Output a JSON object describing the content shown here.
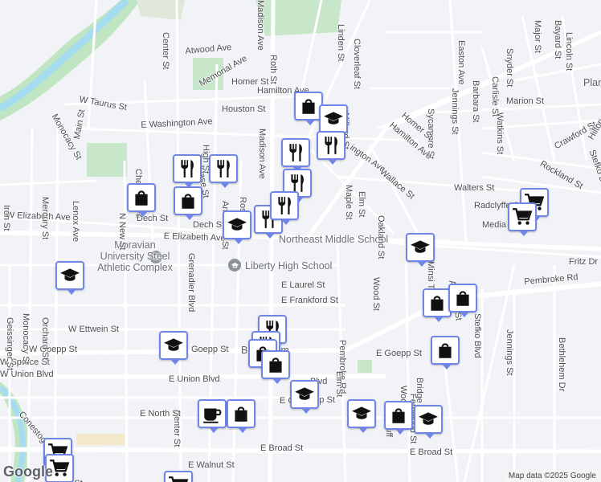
{
  "map": {
    "brand": "Google",
    "attribution": "Map data ©2025 Google"
  },
  "poi": {
    "schools": [
      {
        "name": "Northeast Middle School"
      },
      {
        "name": "Liberty High School"
      },
      {
        "name": "Moravian University Steel Athletic Complex"
      }
    ]
  },
  "labels": {
    "streets": [
      "W Taurus St",
      "Monocacy St",
      "Main St",
      "Chelsea Ave",
      "Lenox Ave",
      "N New St",
      "Center St",
      "Atwood Ave",
      "Memorial Ave",
      "Homer St",
      "Hamilton Ave",
      "Houston St",
      "E Washington Ave",
      "High St",
      "Klase St",
      "Madison Ave",
      "Roth St",
      "Linden St",
      "Cloverleaf St",
      "Millard St",
      "W Elizabeth Ave",
      "E Elizabeth Ave",
      "Dech St",
      "Anderson St",
      "Rose Ave",
      "Grenadier Blvd",
      "E Laurel St",
      "E Frankford St",
      "W Ettwein St",
      "W Goepp St",
      "E Goepp St",
      "W Spruce St",
      "W Union Blvd",
      "E Union Blvd",
      "E North St",
      "E Broad St",
      "E Walnut St",
      "Pembroke Rd",
      "Easton Ave",
      "Jennings St",
      "Barbara St",
      "Carlisle St",
      "Sycamore St",
      "Watkins St",
      "Marion St",
      "Snyder St",
      "Major St",
      "Bayard St",
      "Lincoln St",
      "Maple St",
      "Elm St",
      "Wallace St",
      "Oakland St",
      "Walters St",
      "Radclyffe St",
      "Media St",
      "Crawford St",
      "Rockland St",
      "Hilton St",
      "Stefko Blvd",
      "Fritz Dr",
      "Mincer St",
      "Arcadia St",
      "Bethlehem Dr",
      "Wood St",
      "Fernwood St",
      "Woodruff St",
      "Bridge St",
      "Geissinger St",
      "Orchard St",
      "Mercury St",
      "Irons St",
      "Conestoga St",
      "Broad St",
      "Ettwein St"
    ],
    "labels_visible": [
      {
        "key": "w_taurus",
        "text": "W Taurus St"
      },
      {
        "key": "monocacy",
        "text": "Monocacy St"
      },
      {
        "key": "main",
        "text": "Main St"
      },
      {
        "key": "chelsea",
        "text": "Chelsea Ave"
      },
      {
        "key": "lenox",
        "text": "Lenox Ave"
      },
      {
        "key": "n_new",
        "text": "N New St"
      },
      {
        "key": "center_top",
        "text": "Center St"
      },
      {
        "key": "center_bot",
        "text": "Center St"
      },
      {
        "key": "atwood",
        "text": "Atwood Ave"
      },
      {
        "key": "memorial",
        "text": "Memorial Ave"
      },
      {
        "key": "homer_w",
        "text": "Homer St"
      },
      {
        "key": "hamilton_w",
        "text": "Hamilton Ave"
      },
      {
        "key": "houston",
        "text": "Houston St"
      },
      {
        "key": "e_washington",
        "text": "E Washington Ave"
      },
      {
        "key": "high",
        "text": "High St"
      },
      {
        "key": "klase",
        "text": "Klase St"
      },
      {
        "key": "madison_top",
        "text": "Madison Ave"
      },
      {
        "key": "madison_mid",
        "text": "Madison Ave"
      },
      {
        "key": "roth",
        "text": "Roth St"
      },
      {
        "key": "linden",
        "text": "Linden St"
      },
      {
        "key": "cloverleaf",
        "text": "Cloverleaf St"
      },
      {
        "key": "millard",
        "text": "Millard St"
      },
      {
        "key": "w_elizabeth",
        "text": "W Elizabeth Ave"
      },
      {
        "key": "e_elizabeth",
        "text": "E Elizabeth Ave"
      },
      {
        "key": "dech_w",
        "text": "Dech St"
      },
      {
        "key": "dech_e",
        "text": "Dech St"
      },
      {
        "key": "anderson",
        "text": "Anderson St"
      },
      {
        "key": "rose",
        "text": "Rose Ave"
      },
      {
        "key": "grenadier",
        "text": "Grenadier Blvd"
      },
      {
        "key": "e_laurel",
        "text": "E Laurel St"
      },
      {
        "key": "e_frankford",
        "text": "E Frankford St"
      },
      {
        "key": "w_ettwein",
        "text": "W Ettwein St"
      },
      {
        "key": "w_goepp",
        "text": "W Goepp St"
      },
      {
        "key": "goepp_mid",
        "text": "Goepp St"
      },
      {
        "key": "e_goepp",
        "text": "E Goepp St"
      },
      {
        "key": "w_spruce",
        "text": "W Spruce St"
      },
      {
        "key": "w_union",
        "text": "W Union Blvd"
      },
      {
        "key": "e_union",
        "text": "E Union Blvd"
      },
      {
        "key": "union_frag",
        "text": "Blvd"
      },
      {
        "key": "e_north",
        "text": "E North St"
      },
      {
        "key": "e_broad",
        "text": "E Broad St"
      },
      {
        "key": "e_broad_r",
        "text": "E Broad St"
      },
      {
        "key": "e_walnut",
        "text": "E Walnut St"
      },
      {
        "key": "pembroke",
        "text": "Pembroke Rd"
      },
      {
        "key": "pembroke_r",
        "text": "Pembroke Rd"
      },
      {
        "key": "easton",
        "text": "Easton Ave"
      },
      {
        "key": "jennings_t",
        "text": "Jennings St"
      },
      {
        "key": "barbara",
        "text": "Barbara St"
      },
      {
        "key": "carlisle",
        "text": "Carlisle St"
      },
      {
        "key": "sycamore",
        "text": "Sycamore St"
      },
      {
        "key": "watkins",
        "text": "Watkins St"
      },
      {
        "key": "marion",
        "text": "Marion St"
      },
      {
        "key": "snyder",
        "text": "Snyder St"
      },
      {
        "key": "major",
        "text": "Major St"
      },
      {
        "key": "bayard",
        "text": "Bayard St"
      },
      {
        "key": "lincoln",
        "text": "Lincoln St"
      },
      {
        "key": "homer_e",
        "text": "Homer St"
      },
      {
        "key": "hamilton_e",
        "text": "Hamilton Ave"
      },
      {
        "key": "washington_frag",
        "text": "ington Ave"
      },
      {
        "key": "maple",
        "text": "Maple St"
      },
      {
        "key": "elm_t",
        "text": "Elm St"
      },
      {
        "key": "wallace",
        "text": "Wallace St"
      },
      {
        "key": "oakland",
        "text": "Oakland St"
      },
      {
        "key": "walters",
        "text": "Walters St"
      },
      {
        "key": "radclyffe",
        "text": "Radclyffe St"
      },
      {
        "key": "media",
        "text": "Media St"
      },
      {
        "key": "crawford",
        "text": "Crawford St"
      },
      {
        "key": "rockland",
        "text": "Rockland St"
      },
      {
        "key": "hilton",
        "text": "Hilton St"
      },
      {
        "key": "stefko_t",
        "text": "Stefko Bl"
      },
      {
        "key": "stefko_b",
        "text": "Stefko Blvd"
      },
      {
        "key": "fritz",
        "text": "Fritz Dr"
      },
      {
        "key": "mincer",
        "text": "Minsi Trail St"
      },
      {
        "key": "arcadia",
        "text": "Arcadia St"
      },
      {
        "key": "jennings_b",
        "text": "Jennings St"
      },
      {
        "key": "bethlehem_dr",
        "text": "Bethlehem Dr"
      },
      {
        "key": "wood_t",
        "text": "Wood St"
      },
      {
        "key": "wood_b",
        "text": "Wood St"
      },
      {
        "key": "fernwood",
        "text": "Fernwood St"
      },
      {
        "key": "woodruff",
        "text": "Woodruff"
      },
      {
        "key": "bridge",
        "text": "Bridge St"
      },
      {
        "key": "elm_b",
        "text": "Elm St"
      },
      {
        "key": "geissinger",
        "text": "Geissinger St"
      },
      {
        "key": "monocacy_b",
        "text": "Monocacy St"
      },
      {
        "key": "orchard",
        "text": "Orchard St"
      },
      {
        "key": "mercury",
        "text": "Mercury St"
      },
      {
        "key": "irons",
        "text": "Iron St"
      },
      {
        "key": "conestoga",
        "text": "Conestoga St"
      },
      {
        "key": "broad_frag",
        "text": "Broad St"
      },
      {
        "key": "bethlehem_city",
        "text": "Bethlehem"
      },
      {
        "key": "plan_frag",
        "text": "Plan"
      },
      {
        "key": "egoepp_frag",
        "text": "E Goepp St"
      },
      {
        "key": "e_broad_frag",
        "text": "E G"
      }
    ]
  },
  "markers": [
    {
      "icon": "shopping-bag"
    },
    {
      "icon": "graduation-cap"
    },
    {
      "icon": "restaurant"
    },
    {
      "icon": "restaurant"
    },
    {
      "icon": "restaurant"
    },
    {
      "icon": "restaurant"
    },
    {
      "icon": "restaurant"
    },
    {
      "icon": "shopping-bag"
    },
    {
      "icon": "restaurant"
    },
    {
      "icon": "shopping-bag"
    },
    {
      "icon": "restaurant"
    },
    {
      "icon": "graduation-cap"
    },
    {
      "icon": "graduation-cap"
    },
    {
      "icon": "graduation-cap"
    },
    {
      "icon": "shopping-cart"
    },
    {
      "icon": "shopping-cart"
    },
    {
      "icon": "shopping-bag"
    },
    {
      "icon": "shopping-bag"
    },
    {
      "icon": "shopping-bag"
    },
    {
      "icon": "graduation-cap"
    },
    {
      "icon": "restaurant"
    },
    {
      "icon": "restaurant"
    },
    {
      "icon": "shopping-bag"
    },
    {
      "icon": "shopping-bag"
    },
    {
      "icon": "graduation-cap"
    },
    {
      "icon": "coffee"
    },
    {
      "icon": "shopping-bag"
    },
    {
      "icon": "graduation-cap"
    },
    {
      "icon": "shopping-bag"
    },
    {
      "icon": "graduation-cap"
    },
    {
      "icon": "shopping-cart"
    },
    {
      "icon": "shopping-cart"
    },
    {
      "icon": "shopping-cart"
    }
  ],
  "colors": {
    "background": "#f2f3f6",
    "road": "#ffffff",
    "road_outline": "#d6d9de",
    "river": "#a6dcef",
    "river_bank": "#bfe5c2",
    "park": "#c8e6c9",
    "marker_border": "#6f86e8"
  }
}
